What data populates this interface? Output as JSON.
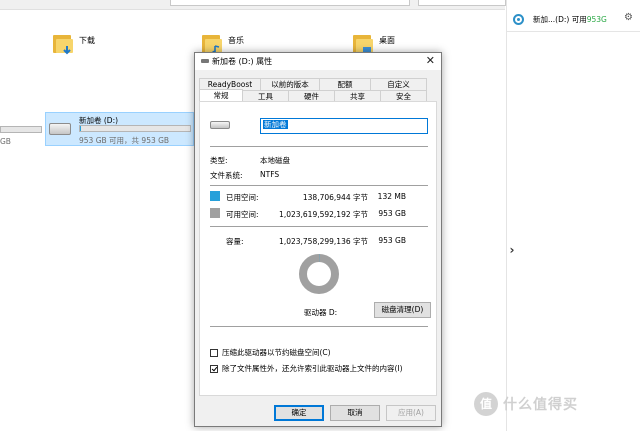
{
  "background": {
    "folders": [
      {
        "label": "下载",
        "icon": "download-folder-icon"
      },
      {
        "label": "音乐",
        "icon": "music-folder-icon"
      },
      {
        "label": "桌面",
        "icon": "desktop-folder-icon"
      }
    ],
    "left_drive": {
      "free_text": "GB"
    },
    "selected_drive": {
      "name": "新加卷 (D:)",
      "free_text": "953 GB 可用，共 953 GB",
      "used_fraction": 0.002
    },
    "right_panel": {
      "status_name": "新加...(D:) 可用 ",
      "status_value": "953G",
      "gear_icon": "gear-icon"
    }
  },
  "dialog": {
    "title": "新加卷 (D:) 属性",
    "tabs_row1": [
      "ReadyBoost",
      "以前的版本",
      "配额",
      "自定义"
    ],
    "tabs_row2": [
      "常规",
      "工具",
      "硬件",
      "共享",
      "安全"
    ],
    "active_tab": "常规",
    "volume_name": "新加卷",
    "type_label": "类型:",
    "type_value": "本地磁盘",
    "fs_label": "文件系统:",
    "fs_value": "NTFS",
    "used": {
      "label": "已用空间:",
      "bytes": "138,706,944 字节",
      "size": "132 MB",
      "color": "#26a0da"
    },
    "free": {
      "label": "可用空间:",
      "bytes": "1,023,619,592,192 字节",
      "size": "953 GB",
      "color": "#a0a0a0"
    },
    "capacity": {
      "label": "容量:",
      "bytes": "1,023,758,299,136 字节",
      "size": "953 GB"
    },
    "drive_label": "驱动器 D:",
    "cleanup_button": "磁盘清理(D)",
    "compress_checkbox": {
      "label": "压缩此驱动器以节约磁盘空间(C)",
      "checked": false
    },
    "index_checkbox": {
      "label": "除了文件属性外，还允许索引此驱动器上文件的内容(I)",
      "checked": true
    },
    "ok_button": "确定",
    "cancel_button": "取消",
    "apply_button": "应用(A)"
  },
  "watermark": {
    "text": "什么值得买",
    "badge": "值"
  }
}
